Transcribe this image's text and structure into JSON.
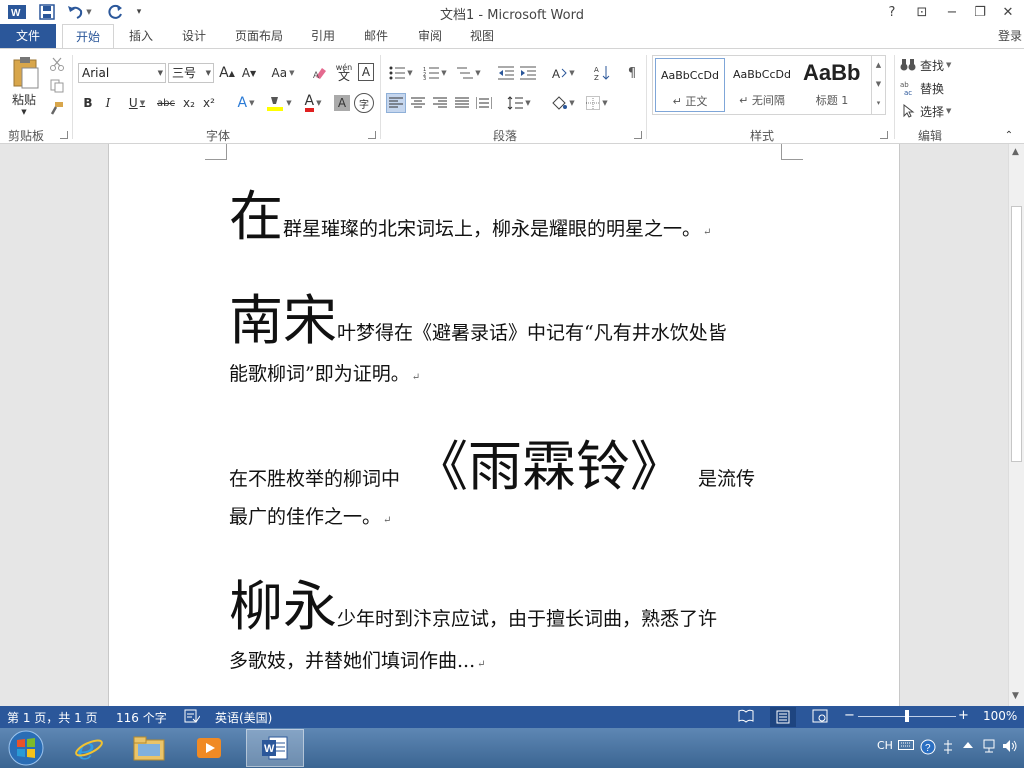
{
  "title_bar": {
    "title": "文档1 - Microsoft Word",
    "help": "?",
    "ribbon_display": "⊡",
    "minimize": "−",
    "restore": "❐",
    "close": "✕"
  },
  "tabs": [
    "文件",
    "开始",
    "插入",
    "设计",
    "页面布局",
    "引用",
    "邮件",
    "审阅",
    "视图"
  ],
  "active_tab": "开始",
  "login": "登录",
  "ribbon": {
    "clipboard": {
      "paste": "粘贴",
      "label": "剪贴板"
    },
    "font": {
      "name": "Arial",
      "size": "三号",
      "grow": "A",
      "shrink": "A",
      "case": "Aa",
      "pinyin": "wén",
      "border_char": "A",
      "bold": "B",
      "italic": "I",
      "underline": "U",
      "strike": "abc",
      "sub": "x₂",
      "sup": "x²",
      "effects": "A",
      "color": "A",
      "shading": "A",
      "enclose": "字",
      "label": "字体"
    },
    "paragraph": {
      "label": "段落"
    },
    "styles": {
      "items": [
        {
          "preview": "AaBbCcDd",
          "name": "正文"
        },
        {
          "preview": "AaBbCcDd",
          "name": "无间隔"
        },
        {
          "preview": "AaBb",
          "name": "标题 1"
        }
      ],
      "label": "样式"
    },
    "editing": {
      "find": "查找",
      "replace": "替换",
      "select": "选择",
      "label": "编辑"
    }
  },
  "document": {
    "p1": {
      "big": "在",
      "rest": "群星璀璨的北宋词坛上，柳永是耀眼的明星之一。"
    },
    "p2": {
      "big": "南宋",
      "rest": "叶梦得在《避暑录话》中记有“凡有井水饮处皆",
      "line2": "能歌柳词”即为证明。"
    },
    "p3": {
      "before": "在不胜枚举的柳词中",
      "big": "《雨霖铃》",
      "after": "是流传",
      "line2": "最广的佳作之一。"
    },
    "p4": {
      "big": "柳永",
      "rest": "少年时到汴京应试，由于擅长词曲，熟悉了许",
      "line2": "多歌妓，并替她们填词作曲..."
    }
  },
  "status": {
    "page": "第 1 页，共 1 页",
    "words": "116 个字",
    "language": "英语(美国)",
    "zoom": "100%",
    "zoom_level_percent": 100
  },
  "taskbar": {
    "lang": "CH"
  }
}
